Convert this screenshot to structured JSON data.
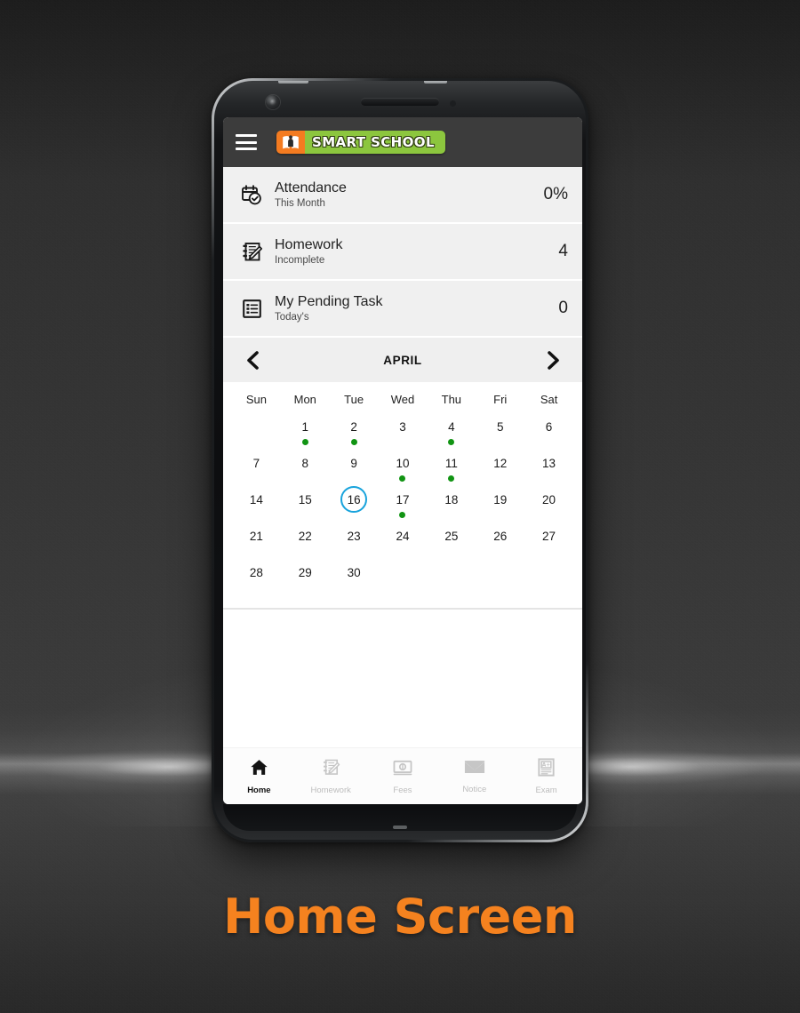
{
  "caption": "Home Screen",
  "colors": {
    "appbar": "#3C3C3C",
    "logo_green": "#8CC63E",
    "logo_orange": "#F47B20",
    "accent_blue": "#18A3DC",
    "event_green": "#119413",
    "caption_orange": "#F5821F",
    "card_bg": "#F0F0F0"
  },
  "appbar": {
    "menu_icon": "hamburger-icon",
    "logo_text": "SMART SCHOOL",
    "logo_mark_icon": "open-book-icon"
  },
  "cards": [
    {
      "icon": "calendar-check-icon",
      "title": "Attendance",
      "subtitle": "This Month",
      "value": "0%"
    },
    {
      "icon": "notebook-pencil-icon",
      "title": "Homework",
      "subtitle": "Incomplete",
      "value": "4"
    },
    {
      "icon": "task-list-icon",
      "title": "My Pending Task",
      "subtitle": "Today's",
      "value": "0"
    }
  ],
  "calendar": {
    "month": "APRIL",
    "prev_icon": "chevron-left-icon",
    "next_icon": "chevron-right-icon",
    "day_names": [
      "Sun",
      "Mon",
      "Tue",
      "Wed",
      "Thu",
      "Fri",
      "Sat"
    ],
    "first_day_offset": 1,
    "days_in_month": 30,
    "selected_day": 16,
    "event_days": [
      1,
      2,
      4,
      10,
      11,
      17
    ]
  },
  "bottom_nav": [
    {
      "label": "Home",
      "icon": "home-icon",
      "active": true
    },
    {
      "label": "Homework",
      "icon": "notebook-pencil-icon",
      "active": false
    },
    {
      "label": "Fees",
      "icon": "banknote-icon",
      "active": false
    },
    {
      "label": "Notice",
      "icon": "envelope-icon",
      "active": false
    },
    {
      "label": "Exam",
      "icon": "exam-paper-icon",
      "active": false
    }
  ]
}
